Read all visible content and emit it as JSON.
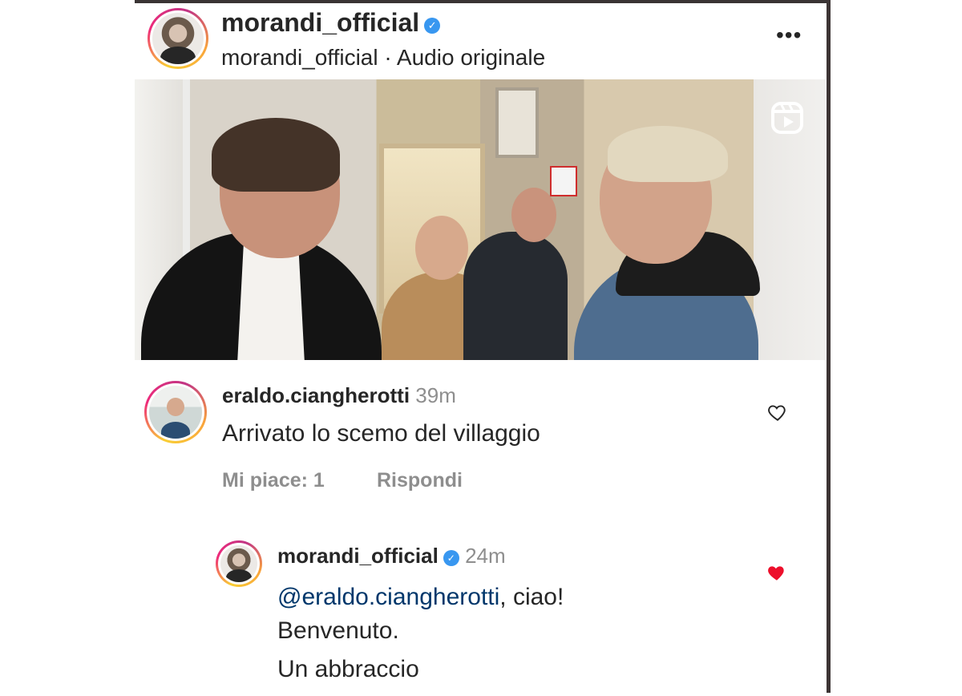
{
  "post": {
    "username": "morandi_official",
    "verified": true,
    "subtitle": "morandi_official · Audio originale",
    "more_icon": "more-horizontal-icon",
    "media_badge_icon": "reels-icon"
  },
  "comments": [
    {
      "username": "eraldo.ciangherotti",
      "time": "39m",
      "text": "Arrivato lo scemo del villaggio",
      "likes_label": "Mi piace: 1",
      "reply_label": "Rispondi",
      "liked": false
    }
  ],
  "reply": {
    "username": "morandi_official",
    "verified": true,
    "time": "24m",
    "mention": "@eraldo.ciangherotti",
    "text_after_mention": ", ciao!",
    "line2": "Benvenuto.",
    "line3": "Un abbraccio",
    "liked": true
  },
  "colors": {
    "verified_blue": "#3897f0",
    "like_red": "#ed4956",
    "mention_blue": "#00376b",
    "secondary_text": "#8e8e8e"
  }
}
